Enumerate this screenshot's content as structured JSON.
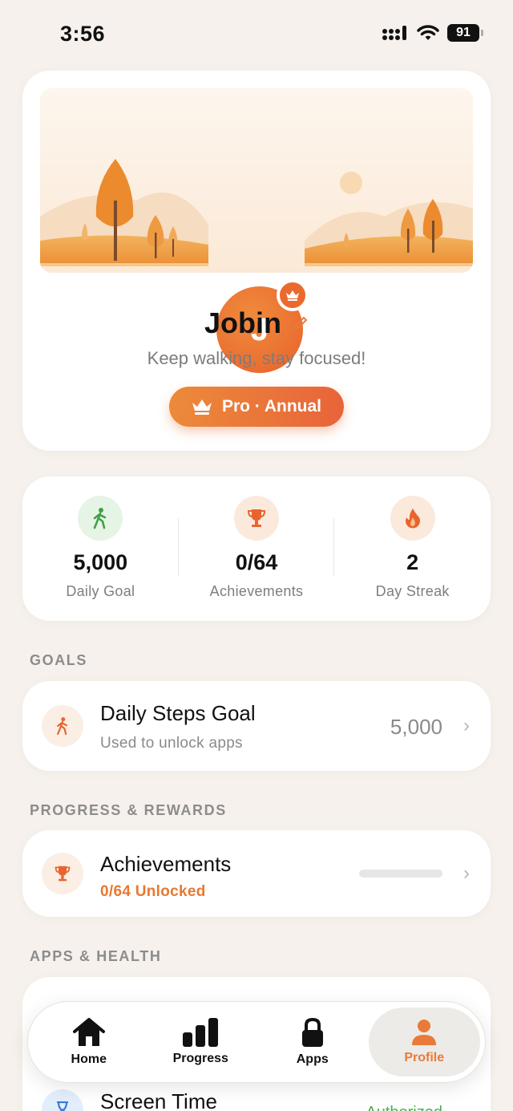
{
  "status_bar": {
    "time": "3:56",
    "battery": "91"
  },
  "profile": {
    "initial": "J",
    "name": "Jobin",
    "tagline": "Keep walking, stay focused!",
    "plan_label": "Pro · Annual"
  },
  "stats": [
    {
      "value": "5,000",
      "label": "Daily Goal",
      "icon": "walking-icon"
    },
    {
      "value": "0/64",
      "label": "Achievements",
      "icon": "trophy-icon"
    },
    {
      "value": "2",
      "label": "Day Streak",
      "icon": "flame-icon"
    }
  ],
  "sections": {
    "goals": "GOALS",
    "progress_rewards": "PROGRESS & REWARDS",
    "apps_health": "APPS & HEALTH"
  },
  "goals": {
    "title": "Daily Steps Goal",
    "subtitle": "Used to unlock apps",
    "value": "5,000"
  },
  "achievements": {
    "title": "Achievements",
    "subtitle": "0/64 Unlocked",
    "progress": 0
  },
  "apps_health": {
    "screen_time_title": "Screen Time",
    "screen_time_status": "Authorized"
  },
  "tab_bar": {
    "tabs": [
      {
        "label": "Home",
        "icon": "home-icon"
      },
      {
        "label": "Progress",
        "icon": "bar-chart-icon"
      },
      {
        "label": "Apps",
        "icon": "lock-icon"
      },
      {
        "label": "Profile",
        "icon": "person-icon"
      }
    ],
    "active": "Profile"
  },
  "colors": {
    "accent": "#ea7a38",
    "background": "#f6f1ec",
    "success": "#4caf50"
  }
}
